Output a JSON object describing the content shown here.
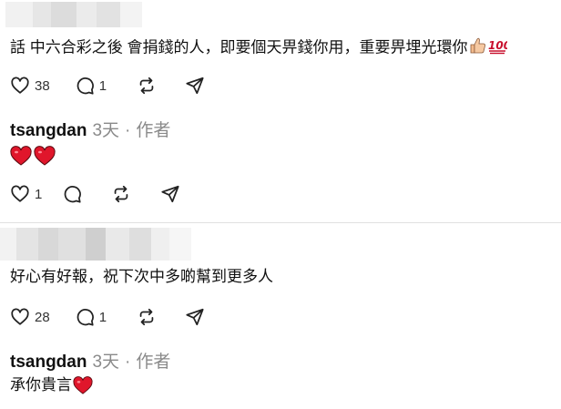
{
  "comments": [
    {
      "text": "話 中六合彩之後 會捐錢的人，即要個天畀錢你用，重要畀埋光環你",
      "actions": {
        "likes": "38",
        "replies": "1"
      }
    },
    {
      "author": "tsangdan",
      "time": "3天",
      "separator": "·",
      "role": "作者",
      "actions": {
        "likes": "1"
      }
    },
    {
      "text": "好心有好報，祝下次中多啲幫到更多人",
      "actions": {
        "likes": "28",
        "replies": "1"
      }
    },
    {
      "author": "tsangdan",
      "time": "3天",
      "separator": "·",
      "role": "作者",
      "text": "承你貴言"
    }
  ],
  "colors": {
    "heart_red": "#e0162b",
    "muted": "#8a8a8a",
    "icon": "#222222",
    "divider": "#e0e0e0"
  },
  "icons": [
    "heart-icon",
    "comment-icon",
    "repost-icon",
    "share-icon",
    "thumbs-up-emoji",
    "hundred-points-emoji",
    "red-heart-emoji"
  ]
}
